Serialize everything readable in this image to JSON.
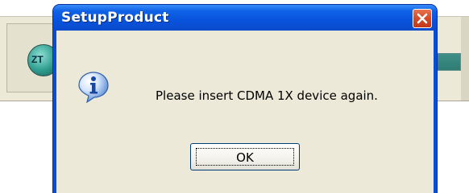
{
  "background_window": {
    "logo_text": "ZT"
  },
  "dialog": {
    "title": "SetupProduct",
    "message": "Please insert CDMA 1X device again.",
    "ok_label": "OK",
    "icon": "info-icon",
    "close_icon": "close-icon"
  },
  "colors": {
    "titlebar": "#0a4fd3",
    "dialog_bg": "#ece9d8",
    "close_button": "#d34a27"
  }
}
